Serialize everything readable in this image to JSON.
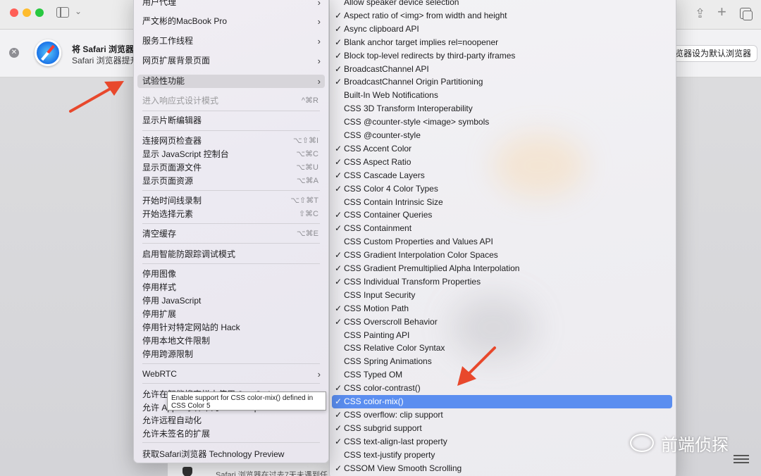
{
  "banner": {
    "title": "将 Safari 浏览器设",
    "subtitle": "Safari 浏览器提升",
    "button": "览器设为默认浏览器",
    "bottom_text": "Safari 浏览器在过去7天未遇到任"
  },
  "dev_menu": {
    "items": [
      {
        "label": "用户代理",
        "arrow": "›"
      },
      {
        "label": "严文彬的MacBook Pro",
        "arrow": "›"
      },
      {
        "label": "服务工作线程",
        "arrow": "›"
      },
      {
        "label": "网页扩展背景页面",
        "arrow": "›"
      },
      {
        "label": "试验性功能",
        "arrow": "›"
      },
      {
        "label": "进入响应式设计模式",
        "shortcut": "^⌘R"
      },
      {
        "label": "显示片断编辑器"
      },
      {
        "label": "连接网页检查器",
        "shortcut": "⌥⇧⌘I"
      },
      {
        "label": "显示 JavaScript 控制台",
        "shortcut": "⌥⌘C"
      },
      {
        "label": "显示页面源文件",
        "shortcut": "⌥⌘U"
      },
      {
        "label": "显示页面资源",
        "shortcut": "⌥⌘A"
      },
      {
        "label": "开始时间线录制",
        "shortcut": "⌥⇧⌘T"
      },
      {
        "label": "开始选择元素",
        "shortcut": "⇧⌘C"
      },
      {
        "label": "清空缓存",
        "shortcut": "⌥⌘E"
      },
      {
        "label": "启用智能防跟踪调试模式"
      },
      {
        "label": "停用图像"
      },
      {
        "label": "停用样式"
      },
      {
        "label": "停用 JavaScript"
      },
      {
        "label": "停用扩展"
      },
      {
        "label": "停用针对特定网站的 Hack"
      },
      {
        "label": "停用本地文件限制"
      },
      {
        "label": "停用跨源限制"
      },
      {
        "label": "WebRTC",
        "arrow": "›"
      },
      {
        "label": "允许在智能搜索栏中使用 JavaScript"
      },
      {
        "label": "允许 Apple 事件中的 JavaScript"
      },
      {
        "label": "允许远程自动化"
      },
      {
        "label": "允许未签名的扩展"
      },
      {
        "label": "获取Safari浏览器 Technology Preview"
      }
    ]
  },
  "tooltip": {
    "line1": "Enable support for CSS color-mix() defined in",
    "line2": "CSS Color 5"
  },
  "features": [
    {
      "label": "Allow speaker device selection",
      "checked": false
    },
    {
      "label": "Aspect ratio of <img> from width and height",
      "checked": true
    },
    {
      "label": "Async clipboard API",
      "checked": true
    },
    {
      "label": "Blank anchor target implies rel=noopener",
      "checked": true
    },
    {
      "label": "Block top-level redirects by third-party iframes",
      "checked": true
    },
    {
      "label": "BroadcastChannel API",
      "checked": true
    },
    {
      "label": "BroadcastChannel Origin Partitioning",
      "checked": true
    },
    {
      "label": "Built-In Web Notifications",
      "checked": false
    },
    {
      "label": "CSS 3D Transform Interoperability",
      "checked": false
    },
    {
      "label": "CSS @counter-style <image> symbols",
      "checked": false
    },
    {
      "label": "CSS @counter-style",
      "checked": false
    },
    {
      "label": "CSS Accent Color",
      "checked": true
    },
    {
      "label": "CSS Aspect Ratio",
      "checked": true
    },
    {
      "label": "CSS Cascade Layers",
      "checked": true
    },
    {
      "label": "CSS Color 4 Color Types",
      "checked": true
    },
    {
      "label": "CSS Contain Intrinsic Size",
      "checked": false
    },
    {
      "label": "CSS Container Queries",
      "checked": true
    },
    {
      "label": "CSS Containment",
      "checked": true
    },
    {
      "label": "CSS Custom Properties and Values API",
      "checked": false
    },
    {
      "label": "CSS Gradient Interpolation Color Spaces",
      "checked": true
    },
    {
      "label": "CSS Gradient Premultiplied Alpha Interpolation",
      "checked": true
    },
    {
      "label": "CSS Individual Transform Properties",
      "checked": true
    },
    {
      "label": "CSS Input Security",
      "checked": false
    },
    {
      "label": "CSS Motion Path",
      "checked": true
    },
    {
      "label": "CSS Overscroll Behavior",
      "checked": true
    },
    {
      "label": "CSS Painting API",
      "checked": false
    },
    {
      "label": "CSS Relative Color Syntax",
      "checked": false
    },
    {
      "label": "CSS Spring Animations",
      "checked": false
    },
    {
      "label": "CSS Typed OM",
      "checked": false
    },
    {
      "label": "CSS color-contrast()",
      "checked": true
    },
    {
      "label": "CSS color-mix()",
      "checked": true,
      "selected": true
    },
    {
      "label": "CSS overflow: clip support",
      "checked": true
    },
    {
      "label": "CSS subgrid support",
      "checked": true
    },
    {
      "label": "CSS text-align-last property",
      "checked": true
    },
    {
      "label": "CSS text-justify property",
      "checked": false
    },
    {
      "label": "CSSOM View Smooth Scrolling",
      "checked": true
    }
  ],
  "watermark": "前端侦探",
  "colors": {
    "selection": "#5b8ef0",
    "arrow": "#e8482c"
  },
  "icons": {
    "check": "✓"
  }
}
